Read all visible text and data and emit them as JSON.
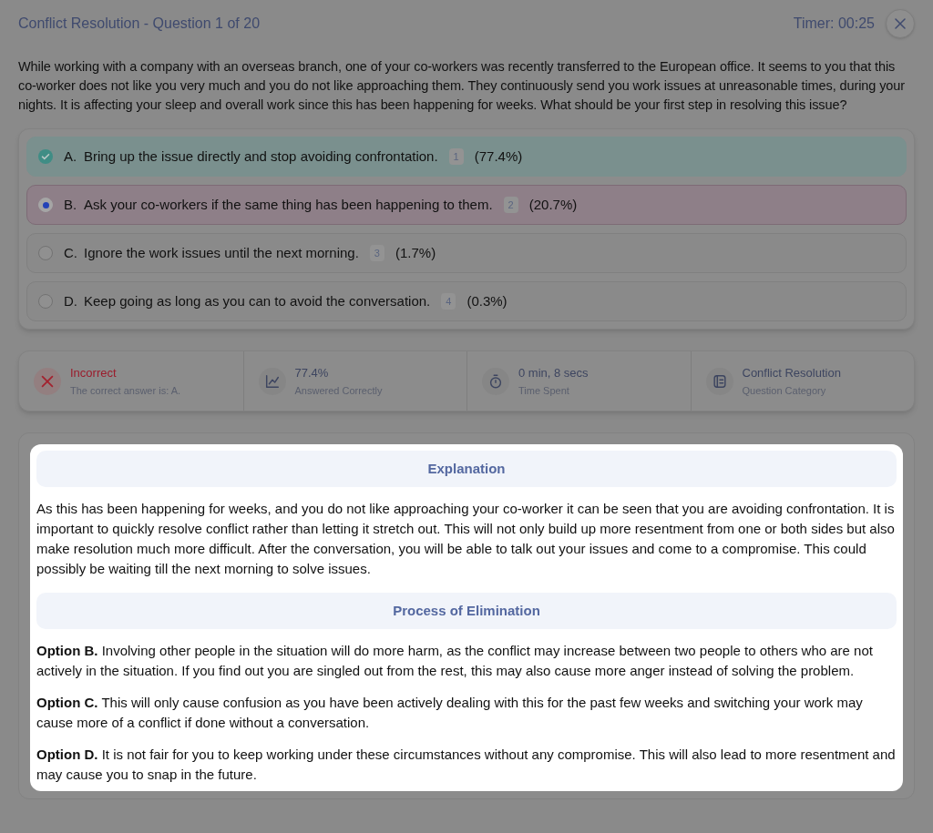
{
  "header": {
    "title": "Conflict Resolution - Question 1 of 20",
    "timer": "Timer: 00:25"
  },
  "question": "While working with a company with an overseas branch, one of your co-workers was recently transferred to the European office. It seems to you that this co-worker does not like you very much and you do not like approaching them. They continuously send you work issues at unreasonable times, during your nights. It is affecting your sleep and overall work since this has been happening for weeks. What should be your first step in resolving this issue?",
  "options": [
    {
      "letter": "A.",
      "text": "Bring up the issue directly and stop avoiding confrontation.",
      "key": "1",
      "share": "(77.4%)",
      "correct": true,
      "selected": false
    },
    {
      "letter": "B.",
      "text": "Ask your co-workers if the same thing has been happening to them.",
      "key": "2",
      "share": "(20.7%)",
      "correct": false,
      "selected": true
    },
    {
      "letter": "C.",
      "text": "Ignore the work issues until the next morning.",
      "key": "3",
      "share": "(1.7%)",
      "correct": false,
      "selected": false
    },
    {
      "letter": "D.",
      "text": "Keep going as long as you can to avoid the conversation.",
      "key": "4",
      "share": "(0.3%)",
      "correct": false,
      "selected": false
    }
  ],
  "stats": [
    {
      "kind": "result",
      "value": "Incorrect",
      "label": "The correct answer is: A."
    },
    {
      "kind": "chart",
      "value": "77.4%",
      "label": "Answered Correctly"
    },
    {
      "kind": "timer",
      "value": "0 min, 8 secs",
      "label": "Time Spent"
    },
    {
      "kind": "category",
      "value": "Conflict Resolution",
      "label": "Question Category"
    }
  ],
  "explanation": {
    "title": "Explanation",
    "text": "As this has been happening for weeks, and you do not like approaching your co-worker it can be seen that you are avoiding confrontation. It is important to quickly resolve conflict rather than letting it stretch out. This will not only build up more resentment from one or both sides but also make resolution much more difficult. After the conversation, you will be able to talk out your issues and come to a compromise. This could possibly be waiting till the next morning to solve issues."
  },
  "elimination": {
    "title": "Process of Elimination",
    "items": [
      "**Option B.** Involving other people in the situation will do more harm, as the conflict may increase between two people to others who are not actively in the situation. If you find out you are singled out from the rest, this may also cause more anger instead of solving the problem.",
      "**Option C.** This will only cause confusion as you have been actively dealing with this for the past few weeks and switching your work may cause more of a conflict if done without a conversation.",
      "**Option D.** It is not fair for you to keep working under these circumstances without any compromise. This will also lead to more resentment and may cause you to snap in the future."
    ]
  }
}
